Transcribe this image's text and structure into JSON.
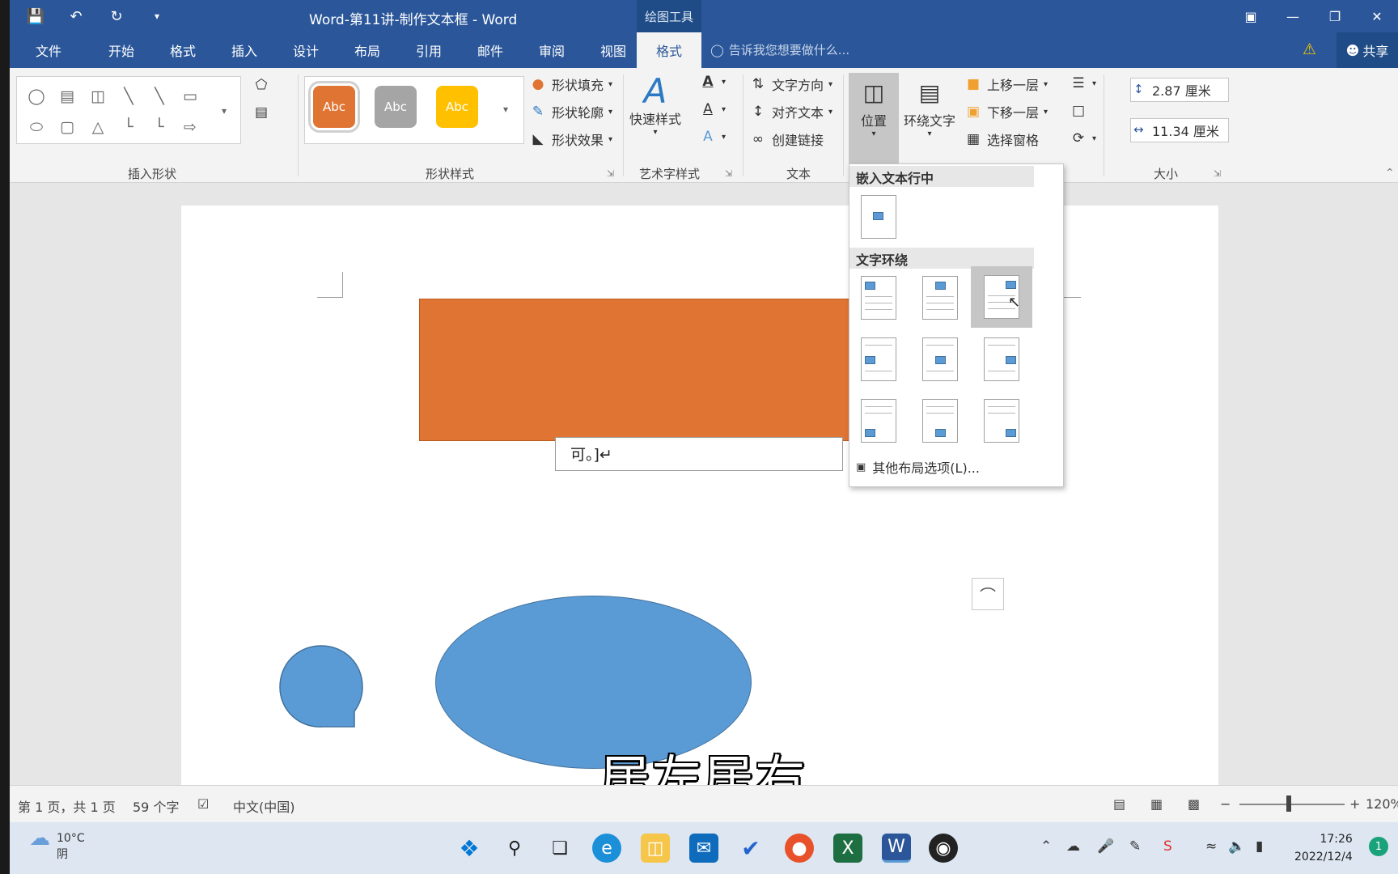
{
  "title_bar": {
    "document_title": "Word-第11讲-制作文本框 - Word",
    "context_tab": "绘图工具",
    "qat_icons": [
      "save-icon",
      "undo-icon",
      "redo-icon",
      "customize-icon"
    ],
    "window_controls": [
      "ribbon-display-icon",
      "minimize-icon",
      "restore-icon",
      "close-icon"
    ]
  },
  "menu": {
    "tabs": [
      "文件",
      "开始",
      "格式",
      "插入",
      "设计",
      "布局",
      "引用",
      "邮件",
      "审阅",
      "视图",
      "格式"
    ],
    "active_tab_index": 10,
    "tell_me": "告诉我您想要做什么...",
    "share": "共享"
  },
  "ribbon": {
    "groups": {
      "insert_shapes": "插入形状",
      "shape_styles": "形状样式",
      "wordart_styles": "艺术字样式",
      "text": "文本",
      "size": "大小"
    },
    "style_swatches": [
      {
        "label": "Abc",
        "color": "#e07432"
      },
      {
        "label": "Abc",
        "color": "#a5a5a5"
      },
      {
        "label": "Abc",
        "color": "#ffc000"
      }
    ],
    "shape_fill": "形状填充",
    "shape_outline": "形状轮廓",
    "shape_effects": "形状效果",
    "quick_styles": "快速样式",
    "text_direction": "文字方向",
    "align_text": "对齐文本",
    "create_link": "创建链接",
    "position": "位置",
    "wrap_text": "环绕文字",
    "bring_forward": "上移一层",
    "send_backward": "下移一层",
    "selection_pane": "选择窗格",
    "height": "2.87 厘米",
    "width": "11.34 厘米"
  },
  "position_dropdown": {
    "inline_header": "嵌入文本行中",
    "wrap_header": "文字环绕",
    "more_options": "其他布局选项(L)..."
  },
  "document": {
    "textbox_text": "可。]↵",
    "subtitle": "居左居右",
    "colors": {
      "orange": "#e07432",
      "blue": "#5b9bd5"
    }
  },
  "status_bar": {
    "page": "第 1 页，共 1 页",
    "words": "59 个字",
    "language": "中文(中国)",
    "zoom": "120%"
  },
  "taskbar": {
    "weather_temp": "10°C",
    "weather_desc": "阴",
    "time": "17:26",
    "date": "2022/12/4",
    "notification_count": "1"
  }
}
